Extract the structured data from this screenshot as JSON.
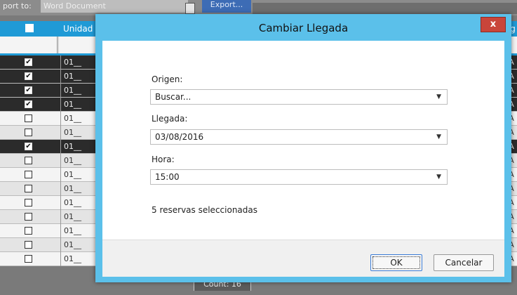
{
  "background": {
    "top_label": "port to:",
    "document_select": "Word Document",
    "export_label": "Export...",
    "grid_header_unidad": "Unidad",
    "grid_header_right": "Ag",
    "rows": [
      {
        "checked": true,
        "unidad": "01__",
        "right": "IA",
        "style": "dark"
      },
      {
        "checked": true,
        "unidad": "01__",
        "right": "IA",
        "style": "dark"
      },
      {
        "checked": true,
        "unidad": "01__",
        "right": "IA",
        "style": "dark"
      },
      {
        "checked": true,
        "unidad": "01__",
        "right": "IA",
        "style": "dark"
      },
      {
        "checked": false,
        "unidad": "01__",
        "right": "IA",
        "style": "light"
      },
      {
        "checked": false,
        "unidad": "01__",
        "right": "IA",
        "style": "alt"
      },
      {
        "checked": true,
        "unidad": "01__",
        "right": "IA",
        "style": "dark"
      },
      {
        "checked": false,
        "unidad": "01__",
        "right": "IA",
        "style": "alt"
      },
      {
        "checked": false,
        "unidad": "01__",
        "right": "IA",
        "style": "light"
      },
      {
        "checked": false,
        "unidad": "01__",
        "right": "IA",
        "style": "alt"
      },
      {
        "checked": false,
        "unidad": "01__",
        "right": "IA",
        "style": "light"
      },
      {
        "checked": false,
        "unidad": "01__",
        "right": "IA",
        "style": "alt"
      },
      {
        "checked": false,
        "unidad": "01__",
        "right": "IA",
        "style": "light"
      },
      {
        "checked": false,
        "unidad": "01__",
        "right": "IA",
        "style": "alt"
      },
      {
        "checked": false,
        "unidad": "01__",
        "right": "IA",
        "style": "light"
      }
    ],
    "count_label": "Count: 16"
  },
  "dialog": {
    "title": "Cambiar Llegada",
    "close_label": "x",
    "origen_label": "Origen:",
    "origen_value": "Buscar...",
    "llegada_label": "Llegada:",
    "llegada_value": "03/08/2016",
    "hora_label": "Hora:",
    "hora_value": "15:00",
    "selection_info": "5 reservas seleccionadas",
    "ok_label": "OK",
    "cancel_label": "Cancelar",
    "dropdown_glyph": "▼"
  },
  "colors": {
    "accent": "#1f9ad6",
    "dialog_frame": "#5bc0ea",
    "close_button": "#c9453a"
  }
}
